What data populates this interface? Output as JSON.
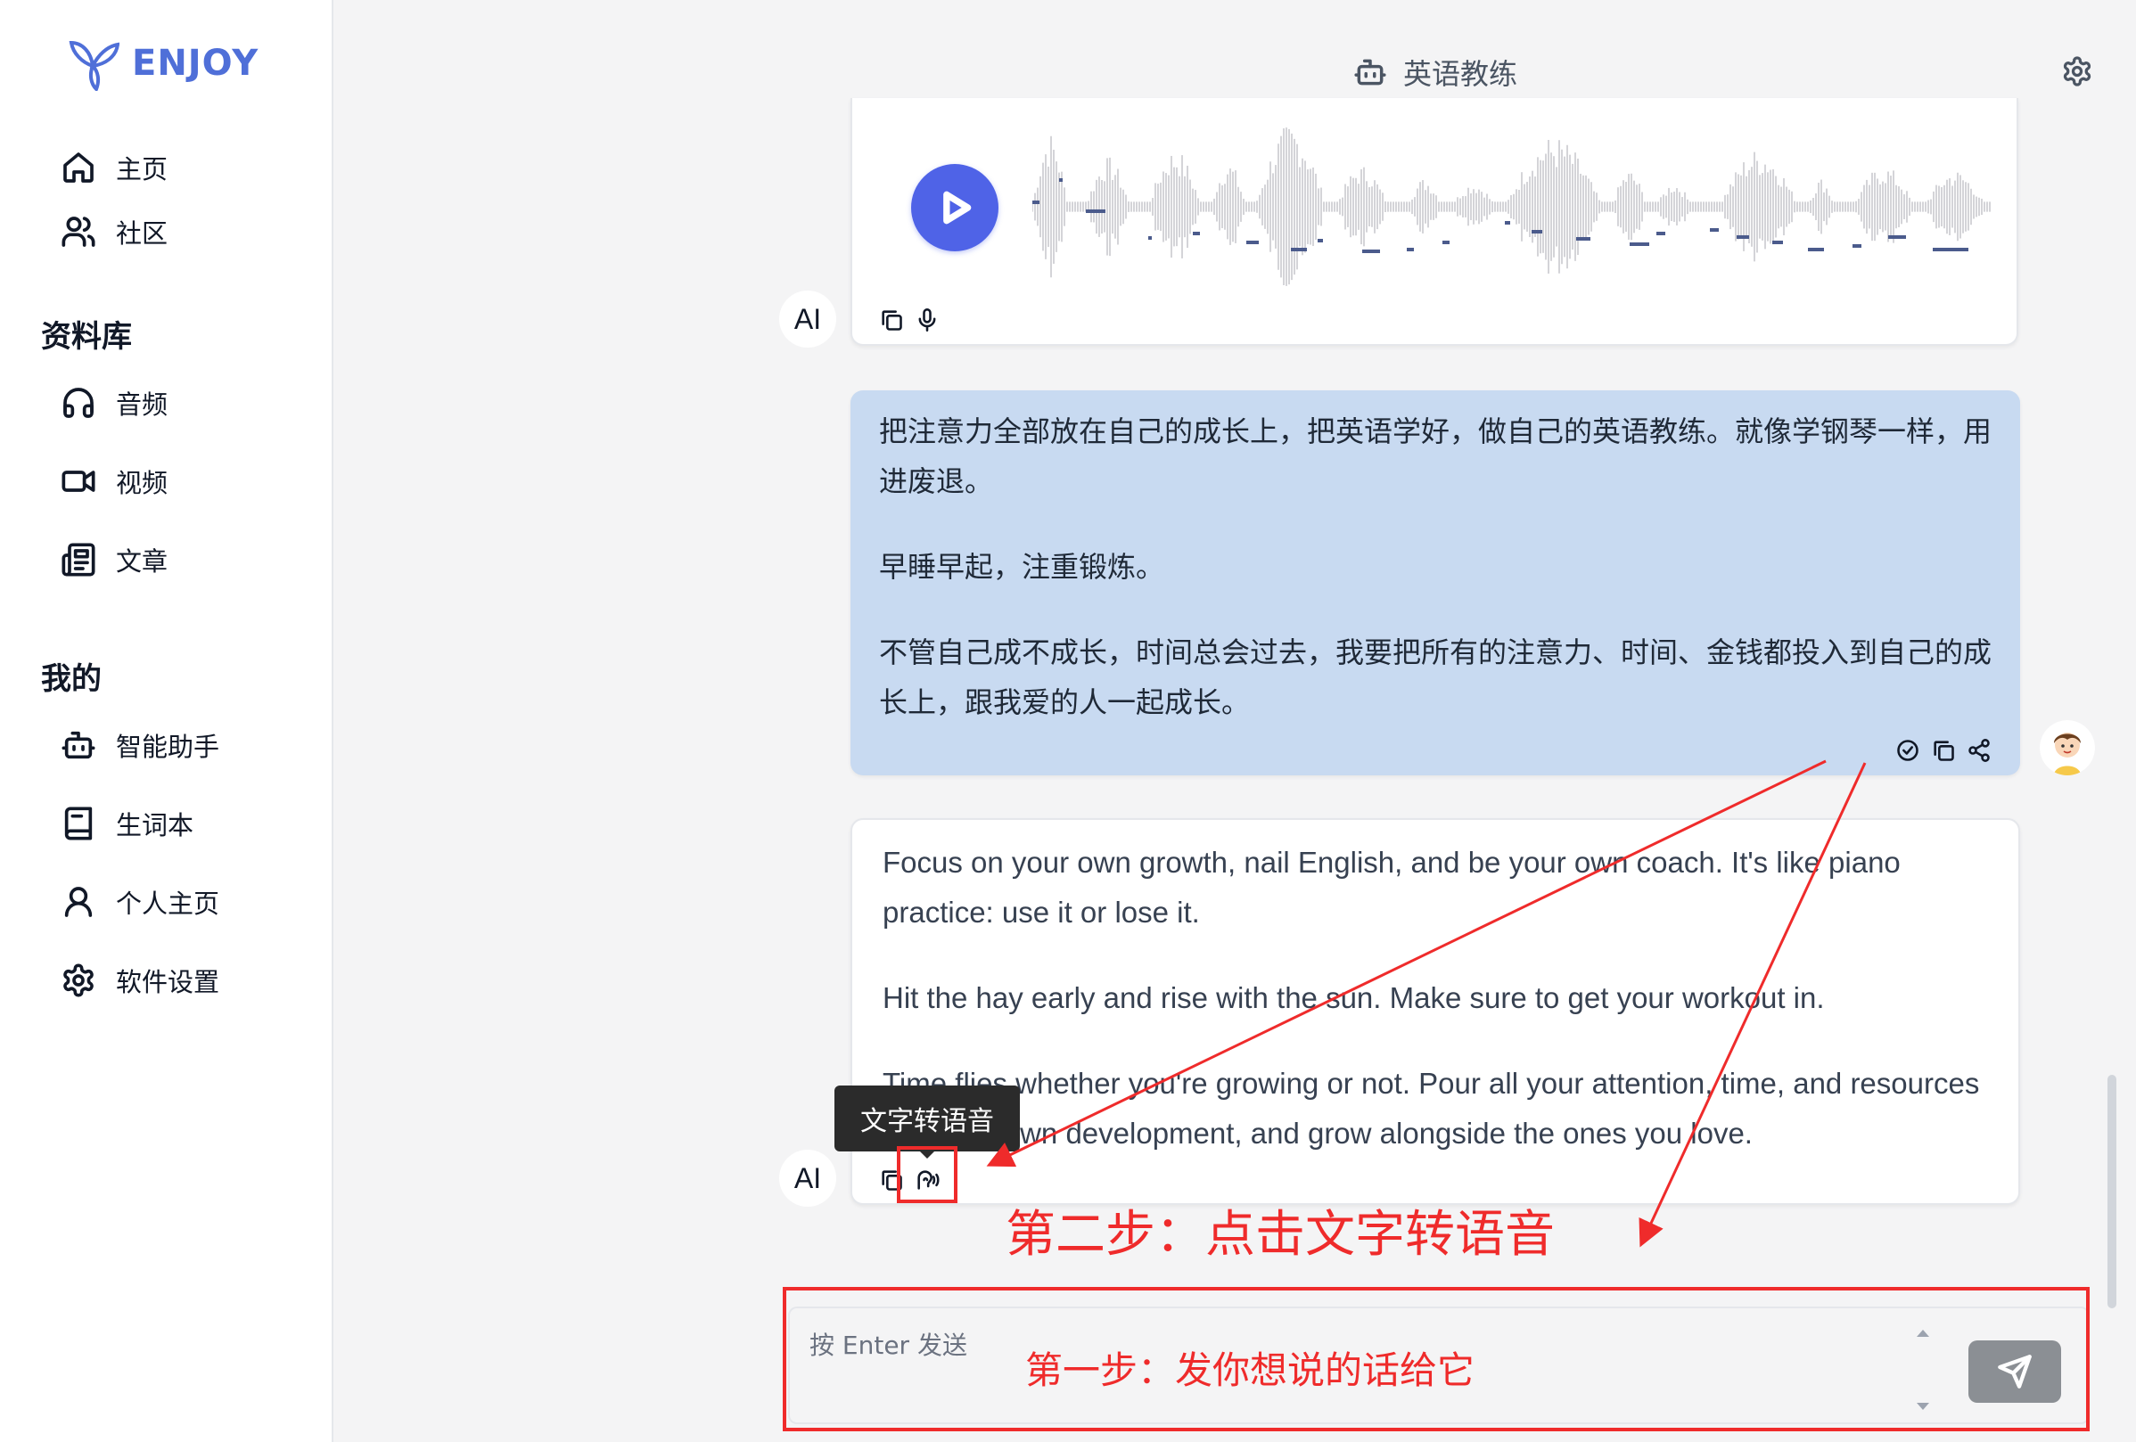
{
  "app": {
    "logo_text": "ENJOY",
    "brand_color": "#4f6fd8"
  },
  "sidebar": {
    "nav": [
      {
        "label": "主页",
        "icon": "home-icon"
      },
      {
        "label": "社区",
        "icon": "users-icon"
      }
    ],
    "library": {
      "title": "资料库",
      "items": [
        {
          "label": "音频",
          "icon": "headphones-icon"
        },
        {
          "label": "视频",
          "icon": "video-icon"
        },
        {
          "label": "文章",
          "icon": "newspaper-icon"
        }
      ]
    },
    "mine": {
      "title": "我的",
      "items": [
        {
          "label": "智能助手",
          "icon": "bot-icon"
        },
        {
          "label": "生词本",
          "icon": "notebook-icon"
        },
        {
          "label": "个人主页",
          "icon": "user-icon"
        },
        {
          "label": "软件设置",
          "icon": "gear-icon"
        }
      ]
    }
  },
  "header": {
    "title": "英语教练",
    "icon": "bot-icon"
  },
  "chat": {
    "ai_label": "AI",
    "user_message": {
      "paragraphs": [
        "把注意力全部放在自己的成长上，把英语学好，做自己的英语教练。就像学钢琴一样，用进废退。",
        "早睡早起，注重锻炼。",
        "不管自己成不成长，时间总会过去，我要把所有的注意力、时间、金钱都投入到自己的成长上，跟我爱的人一起成长。"
      ]
    },
    "ai_reply": {
      "paragraphs": [
        "Focus on your own growth, nail English, and be your own coach. It's like piano practice: use it or lose it.",
        "Hit the hay early and rise with the sun. Make sure to get your workout in.",
        "Time flies whether you're growing or not. Pour all your attention, time, and resources into your own development, and grow alongside the ones you love."
      ]
    },
    "tooltip": "文字转语音"
  },
  "input": {
    "placeholder": "按 Enter 发送"
  },
  "annotations": {
    "step1": "第一步：发你想说的话给它",
    "step2": "第二步：点击文字转语音",
    "color": "#ef2b2b"
  },
  "colors": {
    "user_bubble": "#c8daf1",
    "play_button": "#4f63e7",
    "send_button": "#8b8f94"
  }
}
